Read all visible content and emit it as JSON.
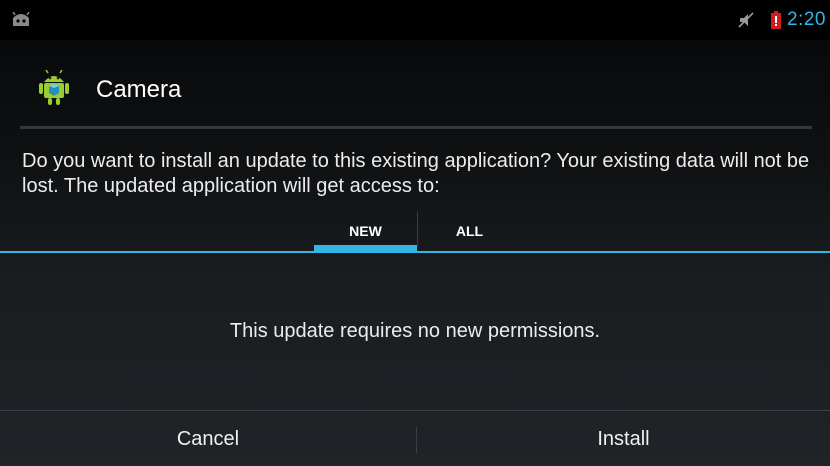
{
  "status_bar": {
    "time": "2:20",
    "icons": [
      "android-notification-icon",
      "mute-icon",
      "battery-low-icon"
    ],
    "accent_color": "#33b5e5",
    "battery_color": "#cc1f1f"
  },
  "dialog": {
    "app_title": "Camera",
    "app_icon": "android-app-icon",
    "message": "Do you want to install an update to this existing application? Your existing data will not be lost. The updated application will get access to:",
    "tabs": [
      {
        "label": "NEW",
        "selected": true
      },
      {
        "label": "ALL",
        "selected": false
      }
    ],
    "content_text": "This update requires no new permissions.",
    "buttons": {
      "cancel_label": "Cancel",
      "install_label": "Install"
    }
  }
}
